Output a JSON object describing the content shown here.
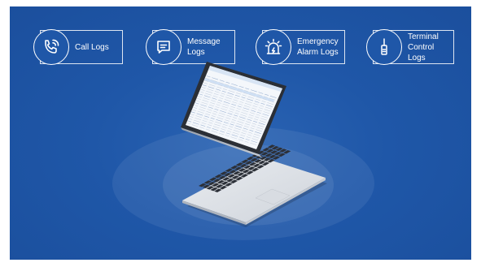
{
  "cards": [
    {
      "label_line1": "Call Logs",
      "label_line2": "",
      "icon": "phone-call-icon"
    },
    {
      "label_line1": "Message",
      "label_line2": "Logs",
      "icon": "message-icon"
    },
    {
      "label_line1": "Emergency",
      "label_line2": "Alarm Logs",
      "icon": "alarm-icon"
    },
    {
      "label_line1": "Terminal",
      "label_line2": "Control Logs",
      "icon": "radio-terminal-icon"
    }
  ],
  "colors": {
    "background": "#1f57a8",
    "stroke": "#ffffff",
    "screen": "#ffffff",
    "laptop_body": "#e6e8ec"
  }
}
